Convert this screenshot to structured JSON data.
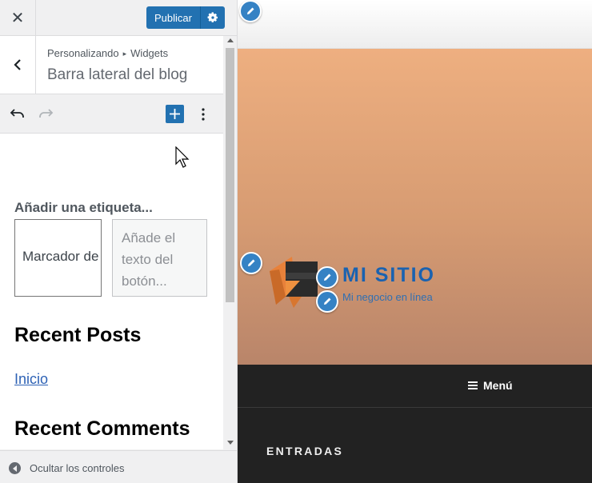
{
  "header": {
    "close_icon": "close-icon",
    "publish_label": "Publicar",
    "settings_icon": "gear-icon"
  },
  "panel": {
    "breadcrumb_root": "Personalizando",
    "breadcrumb_current": "Widgets",
    "title": "Barra lateral del blog"
  },
  "editor": {
    "label_placeholder": "Añadir una etiqueta...",
    "field_value": "Marcador de posición",
    "button_placeholder_lines": [
      "Añade el",
      "texto del",
      "botón..."
    ],
    "recent_posts_heading": "Recent Posts",
    "recent_posts_link": "Inicio",
    "recent_comments_heading": "Recent Comments"
  },
  "footer": {
    "collapse_label": "Ocultar los controles"
  },
  "preview": {
    "site_title": "MI SITIO",
    "site_tagline": "Mi negocio en línea",
    "menu_label": "Menú",
    "section_title": "ENTRADAS"
  },
  "colors": {
    "accent": "#2271b1",
    "shortcut_blue": "#3582c4",
    "site_title": "#1a62b0",
    "hero_top": "#eeaf80",
    "hero_bottom": "#b9856a",
    "nav_bg": "#222222"
  }
}
